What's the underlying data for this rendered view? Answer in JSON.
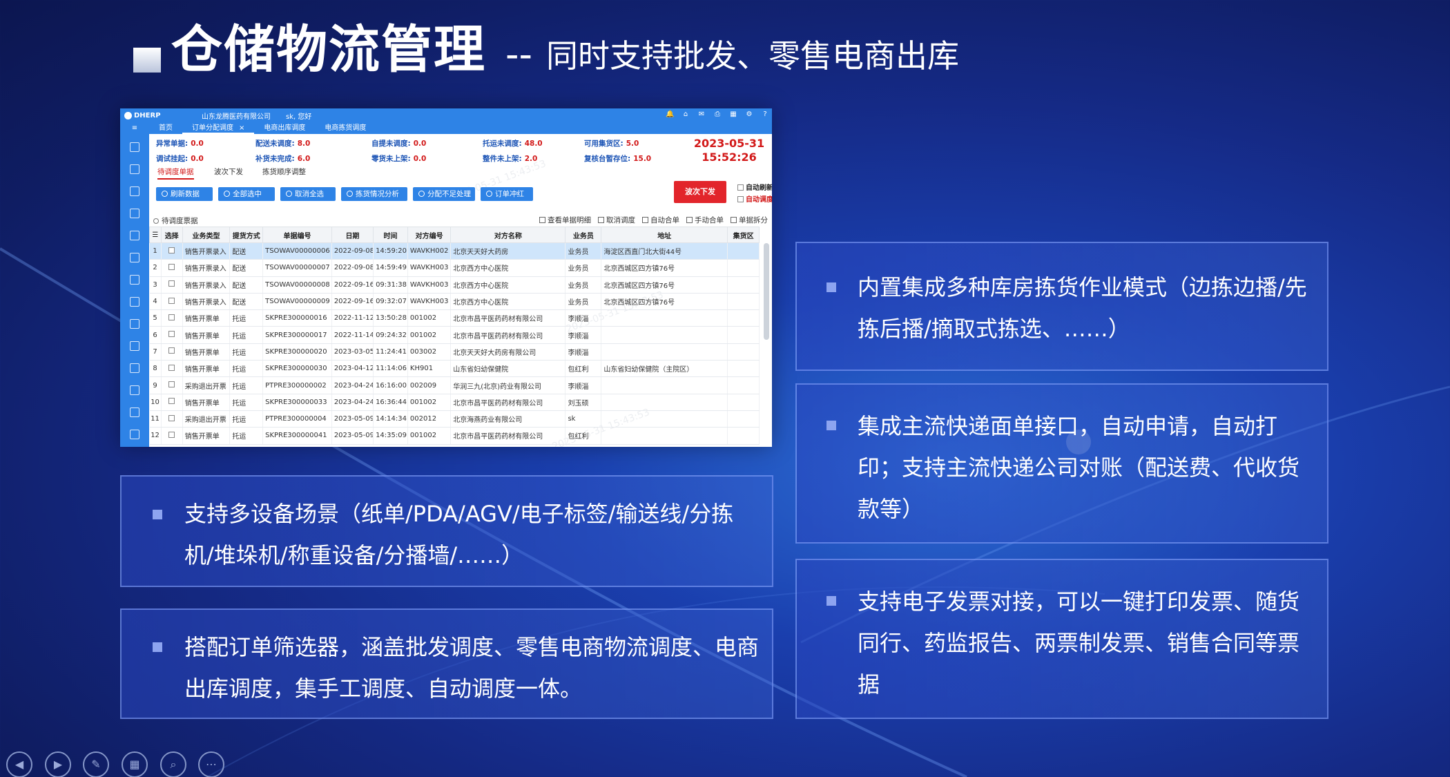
{
  "slide": {
    "title_main": "仓储物流管理",
    "title_sep": "--",
    "title_sub": "同时支持批发、零售电商出库"
  },
  "app": {
    "logo": "DHERP",
    "company": "山东龙腾医药有限公司",
    "greeting": "sk, 您好",
    "tabs": [
      "首页",
      "订单分配调度",
      "电商出库调度",
      "电商拣货调度"
    ],
    "tab_close": "×",
    "stats": [
      {
        "label": "异常单据:",
        "value": "0.0"
      },
      {
        "label": "配送未调度:",
        "value": "8.0"
      },
      {
        "label": "自提未调度:",
        "value": "0.0"
      },
      {
        "label": "托运未调度:",
        "value": "48.0"
      },
      {
        "label": "可用集货区:",
        "value": "5.0"
      },
      {
        "label": "调试挂起:",
        "value": "0.0"
      },
      {
        "label": "补货未完成:",
        "value": "6.0"
      },
      {
        "label": "零货未上架:",
        "value": "0.0"
      },
      {
        "label": "整件未上架:",
        "value": "2.0"
      },
      {
        "label": "复核台暂存位:",
        "value": "15.0"
      }
    ],
    "date": "2023-05-31",
    "time": "15:52:26",
    "subtabs": [
      "待调度单据",
      "波次下发",
      "拣货顺序调整"
    ],
    "buttons": [
      "刷新数据",
      "全部选中",
      "取消全选",
      "拣货情况分析",
      "分配不足处理",
      "订单冲红"
    ],
    "wave_button": "波次下发",
    "checks": [
      "自动刷新",
      "自动调度"
    ],
    "panel_label": "待调度票据",
    "tools": [
      "查看单据明细",
      "取消调度",
      "自动合单",
      "手动合单",
      "单据拆分"
    ],
    "columns": [
      "",
      "选择",
      "业务类型",
      "提货方式",
      "单据编号",
      "日期",
      "时间",
      "对方编号",
      "对方名称",
      "业务员",
      "地址",
      "集货区"
    ],
    "rows": [
      [
        "1",
        "销售开票录入",
        "配送",
        "TSOWAV00000006",
        "2022-09-08",
        "14:59:20",
        "WAVKH002",
        "北京天天好大药房",
        "业务员",
        "海淀区西直门北大街44号"
      ],
      [
        "2",
        "销售开票录入",
        "配送",
        "TSOWAV00000007",
        "2022-09-08",
        "14:59:49",
        "WAVKH003",
        "北京西方中心医院",
        "业务员",
        "北京西城区四方镇76号"
      ],
      [
        "3",
        "销售开票录入",
        "配送",
        "TSOWAV00000008",
        "2022-09-16",
        "09:31:38",
        "WAVKH003",
        "北京西方中心医院",
        "业务员",
        "北京西城区四方镇76号"
      ],
      [
        "4",
        "销售开票录入",
        "配送",
        "TSOWAV00000009",
        "2022-09-16",
        "09:32:07",
        "WAVKH003",
        "北京西方中心医院",
        "业务员",
        "北京西城区四方镇76号"
      ],
      [
        "5",
        "销售开票单",
        "托运",
        "SKPRE300000016",
        "2022-11-12",
        "13:50:28",
        "001002",
        "北京市昌平医药药材有限公司",
        "李顺淄",
        ""
      ],
      [
        "6",
        "销售开票单",
        "托运",
        "SKPRE300000017",
        "2022-11-14",
        "09:24:32",
        "001002",
        "北京市昌平医药药材有限公司",
        "李顺淄",
        ""
      ],
      [
        "7",
        "销售开票单",
        "托运",
        "SKPRE300000020",
        "2023-03-05",
        "11:24:41",
        "003002",
        "北京天天好大药房有限公司",
        "李顺淄",
        ""
      ],
      [
        "8",
        "销售开票单",
        "托运",
        "SKPRE300000030",
        "2023-04-12",
        "11:14:06",
        "KH901",
        "山东省妇幼保健院",
        "包红利",
        "山东省妇幼保健院（主院区）"
      ],
      [
        "9",
        "采购退出开票",
        "托运",
        "PTPRE300000002",
        "2023-04-24",
        "16:16:00",
        "002009",
        "华润三九(北京)药业有限公司",
        "李顺淄",
        ""
      ],
      [
        "10",
        "销售开票单",
        "托运",
        "SKPRE300000033",
        "2023-04-24",
        "16:36:44",
        "001002",
        "北京市昌平医药药材有限公司",
        "刘玉硕",
        ""
      ],
      [
        "11",
        "采购退出开票",
        "托运",
        "PTPRE300000004",
        "2023-05-09",
        "14:14:34",
        "002012",
        "北京海燕药业有限公司",
        "sk",
        ""
      ],
      [
        "12",
        "销售开票单",
        "托运",
        "SKPRE300000041",
        "2023-05-09",
        "14:35:09",
        "001002",
        "北京市昌平医药药材有限公司",
        "包红利",
        ""
      ]
    ],
    "watermark": "2023-05-31 15:43:53"
  },
  "features": [
    "内置集成多种库房拣货作业模式（边拣边播/先拣后播/摘取式拣选、……）",
    "集成主流快递面单接口，自动申请，自动打印；支持主流快递公司对账（配送费、代收货款等）",
    "支持电子发票对接，可以一键打印发票、随货同行、药监报告、两票制发票、销售合同等票据",
    "支持多设备场景（纸单/PDA/AGV/电子标签/输送线/分拣机/堆垛机/称重设备/分播墙/……）",
    "搭配订单筛选器，涵盖批发调度、零售电商物流调度、电商出库调度，集手工调度、自动调度一体。"
  ],
  "controls": [
    "prev-icon",
    "next-icon",
    "pen-icon",
    "grid-icon",
    "zoom-icon",
    "more-icon"
  ]
}
